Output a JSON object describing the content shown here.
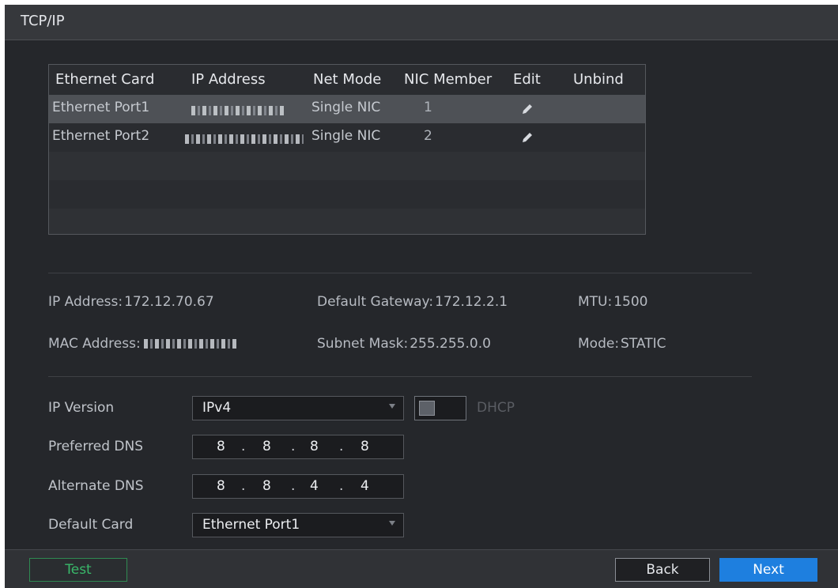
{
  "window": {
    "title": "TCP/IP"
  },
  "table": {
    "headers": [
      "Ethernet Card",
      "IP Address",
      "Net Mode",
      "NIC Member",
      "Edit",
      "Unbind"
    ],
    "rows": [
      {
        "card": "Ethernet Port1",
        "net_mode": "Single NIC",
        "nic_member": "1",
        "selected": true
      },
      {
        "card": "Ethernet Port2",
        "net_mode": "Single NIC",
        "nic_member": "2",
        "selected": false
      }
    ],
    "empty_rows": 3,
    "edit_icon": "pencil-icon"
  },
  "info": {
    "ip_address_label": "IP Address:",
    "ip_address_value": "172.12.70.67",
    "gateway_label": "Default Gateway:",
    "gateway_value": "172.12.2.1",
    "mtu_label": "MTU:",
    "mtu_value": "1500",
    "mac_label": "MAC Address:",
    "mask_label": "Subnet Mask:",
    "mask_value": "255.255.0.0",
    "mode_label": "Mode:",
    "mode_value": "STATIC"
  },
  "form": {
    "ip_version_label": "IP Version",
    "ip_version_value": "IPv4",
    "dhcp_label": "DHCP",
    "dhcp_enabled": false,
    "preferred_dns_label": "Preferred DNS",
    "preferred_dns": [
      "8",
      "8",
      "8",
      "8"
    ],
    "alternate_dns_label": "Alternate DNS",
    "alternate_dns": [
      "8",
      "8",
      "4",
      "4"
    ],
    "default_card_label": "Default Card",
    "default_card_value": "Ethernet Port1"
  },
  "footer": {
    "test_label": "Test",
    "back_label": "Back",
    "next_label": "Next"
  },
  "colors": {
    "accent": "#1e7fdf",
    "test_green": "#39b86a",
    "window_bg": "#25272b"
  }
}
